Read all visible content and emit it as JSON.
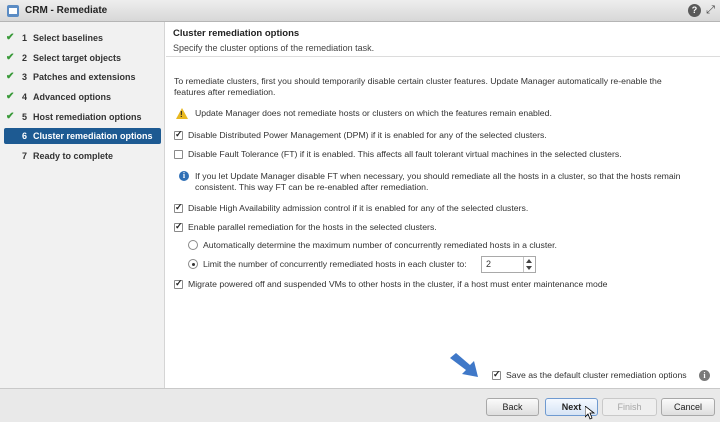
{
  "window": {
    "title": "CRM - Remediate",
    "help_label": "?"
  },
  "steps": [
    {
      "num": "1",
      "label": "Select baselines",
      "done": true
    },
    {
      "num": "2",
      "label": "Select target objects",
      "done": true
    },
    {
      "num": "3",
      "label": "Patches and extensions",
      "done": true
    },
    {
      "num": "4",
      "label": "Advanced options",
      "done": true
    },
    {
      "num": "5",
      "label": "Host remediation options",
      "done": true
    },
    {
      "num": "6",
      "label": "Cluster remediation options",
      "done": false,
      "active": true
    },
    {
      "num": "7",
      "label": "Ready to complete",
      "done": false
    }
  ],
  "header": {
    "title": "Cluster remediation options",
    "subtitle": "Specify the cluster options of the remediation task."
  },
  "content": {
    "intro_line1": "To remediate clusters, first you should temporarily disable certain cluster features. Update Manager automatically re-enable the",
    "intro_line2": "features after remediation.",
    "warning": "Update Manager does not remediate hosts or clusters on which the features remain enabled.",
    "opt_dpm": "Disable Distributed Power Management (DPM) if it is enabled for any of the selected clusters.",
    "opt_ft": "Disable Fault Tolerance (FT) if it is enabled. This affects all fault tolerant virtual machines in the selected clusters.",
    "info_line1": "If you let Update Manager disable FT when necessary, you should remediate all the hosts in a cluster, so that the hosts remain",
    "info_line2": "consistent. This way FT can be re-enabled after remediation.",
    "opt_ha": "Disable High Availability admission control if it is enabled for any of the selected clusters.",
    "opt_parallel": "Enable parallel remediation for the hosts in the selected clusters.",
    "radio_auto": "Automatically determine the maximum number of concurrently remediated hosts in a cluster.",
    "radio_limit": "Limit the number of concurrently remediated hosts in each cluster to:",
    "limit_value": "2",
    "opt_migrate": "Migrate powered off and suspended VMs to other hosts in the cluster, if a host must enter maintenance mode",
    "save_default": "Save as the default cluster remediation options"
  },
  "buttons": {
    "back": "Back",
    "next": "Next",
    "finish": "Finish",
    "cancel": "Cancel"
  },
  "colors": {
    "active_step": "#1d5a92",
    "check": "#3a9a3a",
    "arrow": "#3f78c8"
  }
}
